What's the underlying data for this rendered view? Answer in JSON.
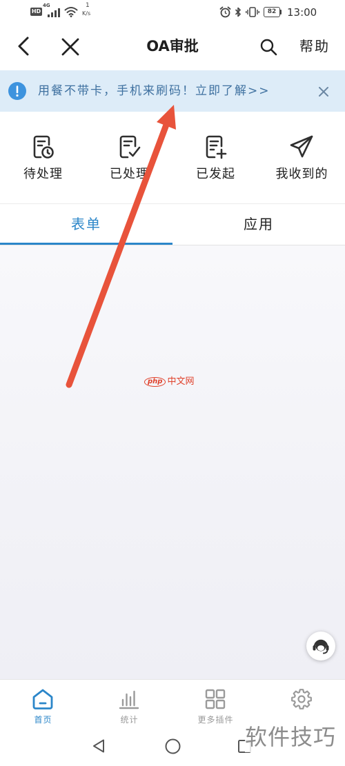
{
  "status_bar": {
    "hd": "HD",
    "network": "4G",
    "speed_value": "1",
    "speed_unit": "K/s",
    "battery": "82",
    "time": "13:00",
    "icons": [
      "signal-icon",
      "wifi-icon",
      "alarm-icon",
      "bluetooth-icon",
      "vibrate-icon",
      "battery-icon"
    ]
  },
  "header": {
    "title": "OA审批",
    "help": "帮助",
    "icons": {
      "back": "chevron-left-icon",
      "close": "close-icon",
      "search": "search-icon"
    }
  },
  "banner": {
    "icon": "info-icon",
    "text": "用餐不带卡，手机来刷码！立即了解>>",
    "close_icon": "close-icon"
  },
  "quick_actions": [
    {
      "label": "待处理",
      "icon": "document-clock-icon"
    },
    {
      "label": "已处理",
      "icon": "document-check-icon"
    },
    {
      "label": "已发起",
      "icon": "document-plus-icon"
    },
    {
      "label": "我收到的",
      "icon": "paper-plane-icon"
    }
  ],
  "tabs": [
    {
      "label": "表单",
      "active": true
    },
    {
      "label": "应用",
      "active": false
    }
  ],
  "floating_button": {
    "icon": "customer-service-icon"
  },
  "bottom_nav": [
    {
      "label": "首页",
      "icon": "home-icon",
      "active": true
    },
    {
      "label": "统计",
      "icon": "bar-chart-icon",
      "active": false
    },
    {
      "label": "更多插件",
      "icon": "grid-icon",
      "active": false
    },
    {
      "icon": "gear-icon",
      "active": false
    }
  ],
  "system_nav": {
    "icons": [
      "back-triangle-icon",
      "home-circle-icon",
      "recents-square-icon"
    ]
  },
  "watermarks": {
    "center_badge": "php",
    "center_text": "中文网",
    "corner": "软件技巧"
  },
  "colors": {
    "accent": "#2b86c9",
    "banner_bg": "#ddecf8",
    "banner_text": "#3f71a0",
    "annotation_arrow": "#e8533b",
    "watermark_red": "#e0402a"
  }
}
